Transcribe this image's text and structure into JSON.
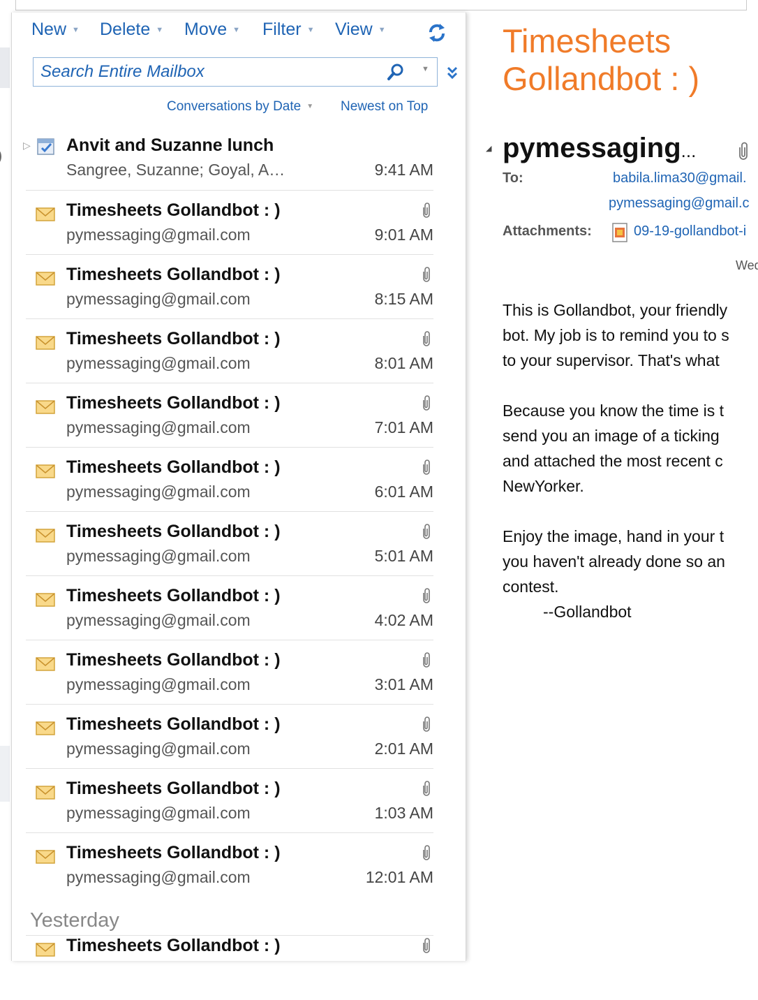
{
  "toolbar": {
    "new_label": "New",
    "delete_label": "Delete",
    "move_label": "Move",
    "filter_label": "Filter",
    "view_label": "View"
  },
  "search": {
    "placeholder": "Search Entire Mailbox"
  },
  "sort": {
    "arrange_label": "Conversations by Date",
    "order_label": "Newest on Top"
  },
  "messages": [
    {
      "subject": "Anvit and Suzanne lunch",
      "sender": "Sangree, Suzanne; Goyal, A…",
      "time": "9:41 AM",
      "icon": "meeting-icon",
      "attachment": false
    },
    {
      "subject": "Timesheets Gollandbot : )",
      "sender": "pymessaging@gmail.com",
      "time": "9:01 AM",
      "icon": "envelope-icon",
      "attachment": true
    },
    {
      "subject": "Timesheets Gollandbot : )",
      "sender": "pymessaging@gmail.com",
      "time": "8:15 AM",
      "icon": "envelope-icon",
      "attachment": true
    },
    {
      "subject": "Timesheets Gollandbot : )",
      "sender": "pymessaging@gmail.com",
      "time": "8:01 AM",
      "icon": "envelope-icon",
      "attachment": true
    },
    {
      "subject": "Timesheets Gollandbot : )",
      "sender": "pymessaging@gmail.com",
      "time": "7:01 AM",
      "icon": "envelope-icon",
      "attachment": true
    },
    {
      "subject": "Timesheets Gollandbot : )",
      "sender": "pymessaging@gmail.com",
      "time": "6:01 AM",
      "icon": "envelope-icon",
      "attachment": true
    },
    {
      "subject": "Timesheets Gollandbot : )",
      "sender": "pymessaging@gmail.com",
      "time": "5:01 AM",
      "icon": "envelope-icon",
      "attachment": true
    },
    {
      "subject": "Timesheets Gollandbot : )",
      "sender": "pymessaging@gmail.com",
      "time": "4:02 AM",
      "icon": "envelope-icon",
      "attachment": true
    },
    {
      "subject": "Timesheets Gollandbot : )",
      "sender": "pymessaging@gmail.com",
      "time": "3:01 AM",
      "icon": "envelope-icon",
      "attachment": true
    },
    {
      "subject": "Timesheets Gollandbot : )",
      "sender": "pymessaging@gmail.com",
      "time": "2:01 AM",
      "icon": "envelope-icon",
      "attachment": true
    },
    {
      "subject": "Timesheets Gollandbot : )",
      "sender": "pymessaging@gmail.com",
      "time": "1:03 AM",
      "icon": "envelope-icon",
      "attachment": true
    },
    {
      "subject": "Timesheets Gollandbot : )",
      "sender": "pymessaging@gmail.com",
      "time": "12:01 AM",
      "icon": "envelope-icon",
      "attachment": true
    }
  ],
  "group_yesterday": {
    "label": "Yesterday",
    "first_subject": "Timesheets Gollandbot : )"
  },
  "reading": {
    "title_line1": "Timesheets",
    "title_line2": "Gollandbot : )",
    "from": "pymessaging",
    "from_ellipsis": "...",
    "to_label": "To:",
    "to_1": "babila.lima30@gmail.",
    "to_2": "pymessaging@gmail.c",
    "attachments_label": "Attachments:",
    "attachment_name": "09-19-gollandbot-i",
    "date_partial": "Wed",
    "body": [
      [
        "This is Gollandbot, your friendly",
        "bot. My job is to remind you to s",
        "to your supervisor. That's what"
      ],
      [
        "Because you know the time is t",
        "send you an image of a ticking",
        "and attached the most recent c",
        "NewYorker."
      ],
      [
        "Enjoy the image, hand in your t",
        "you haven't already done so an",
        "contest."
      ]
    ],
    "signature": "--Gollandbot"
  },
  "colors": {
    "link_blue": "#1f64b4",
    "title_orange": "#f07b29"
  }
}
